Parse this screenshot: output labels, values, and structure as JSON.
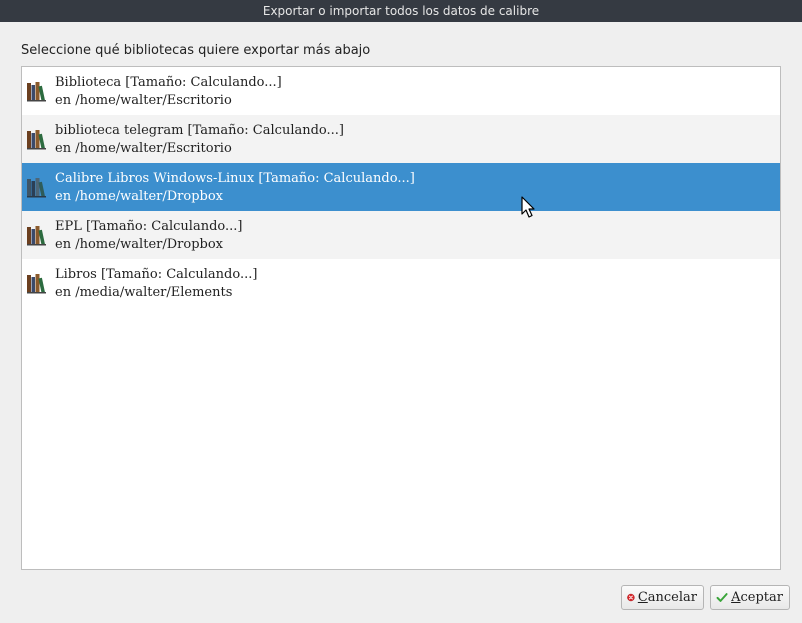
{
  "window": {
    "title": "Exportar o importar todos los datos de calibre"
  },
  "prompt": "Seleccione qué bibliotecas quiere exportar más abajo",
  "libraries": [
    {
      "name": "Biblioteca [Tamaño: Calculando...]",
      "path": "en /home/walter/Escritorio",
      "selected": false
    },
    {
      "name": "biblioteca telegram [Tamaño: Calculando...]",
      "path": "en /home/walter/Escritorio",
      "selected": false
    },
    {
      "name": "Calibre Libros Windows-Linux [Tamaño: Calculando...]",
      "path": "en /home/walter/Dropbox",
      "selected": true
    },
    {
      "name": "EPL [Tamaño: Calculando...]",
      "path": "en /home/walter/Dropbox",
      "selected": false
    },
    {
      "name": "Libros [Tamaño: Calculando...]",
      "path": "en /media/walter/Elements",
      "selected": false
    }
  ],
  "buttons": {
    "cancel": {
      "accel": "C",
      "rest": "ancelar",
      "icon": "cancel-icon"
    },
    "ok": {
      "accel": "A",
      "rest": "ceptar",
      "icon": "checkmark-icon"
    }
  },
  "colors": {
    "selection": "#3c8fce",
    "titlebar": "#353a42",
    "dialog_bg": "#efefef"
  }
}
